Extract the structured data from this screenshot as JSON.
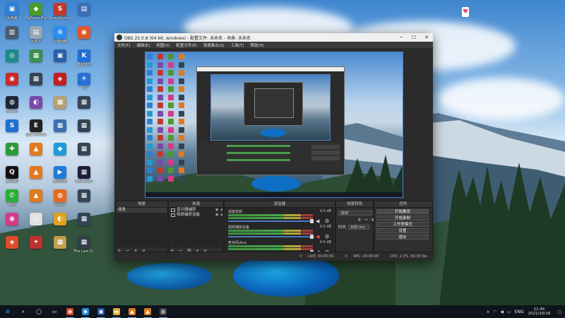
{
  "desktop": {
    "icons": [
      {
        "label": "此电脑",
        "color": "#2f7fd6",
        "glyph": "▣"
      },
      {
        "label": "GeForce Experience",
        "color": "#4c9a2a",
        "glyph": "◆"
      },
      {
        "label": "SnapGene Viewer",
        "color": "#c0392b",
        "glyph": "S"
      },
      {
        "label": "",
        "color": "#3b6fb6",
        "glyph": "▤"
      },
      {
        "label": "",
        "color": "#4a5a6a",
        "glyph": "▥"
      },
      {
        "label": "回收站",
        "color": "#9aa7b3",
        "glyph": "▤"
      },
      {
        "label": "百度网盘",
        "color": "#2d8cf0",
        "glyph": "⊙"
      },
      {
        "label": "",
        "color": "#e05a2b",
        "glyph": "◉"
      },
      {
        "label": "",
        "color": "#1c8b8b",
        "glyph": "◎"
      },
      {
        "label": "",
        "color": "#3d8f4a",
        "glyph": "▦"
      },
      {
        "label": "",
        "color": "#2a5ea8",
        "glyph": "▣"
      },
      {
        "label": "酷狗音乐",
        "color": "#1f6fd9",
        "glyph": "K"
      },
      {
        "label": "",
        "color": "#cc2a2a",
        "glyph": "◉"
      },
      {
        "label": "",
        "color": "#334455",
        "glyph": "▦"
      },
      {
        "label": "",
        "color": "#c02020",
        "glyph": "◈"
      },
      {
        "label": "飞书",
        "color": "#2a6fd6",
        "glyph": "✈"
      },
      {
        "label": "Steam",
        "color": "#1b2838",
        "glyph": "◍"
      },
      {
        "label": "",
        "color": "#7a4aa8",
        "glyph": "◐"
      },
      {
        "label": "",
        "color": "#b8a070",
        "glyph": "▦"
      },
      {
        "label": "",
        "color": "#334455",
        "glyph": "▦"
      },
      {
        "label": "",
        "color": "#1e6fd0",
        "glyph": "S"
      },
      {
        "label": "Epic Games Launcher",
        "color": "#222",
        "glyph": "E"
      },
      {
        "label": "",
        "color": "#3a6fb0",
        "glyph": "▦"
      },
      {
        "label": "",
        "color": "#334455",
        "glyph": "▦"
      },
      {
        "label": "",
        "color": "#2d9a3a",
        "glyph": "✚"
      },
      {
        "label": "",
        "color": "#e07a1f",
        "glyph": "▲"
      },
      {
        "label": "",
        "color": "#1f9bd9",
        "glyph": "◆"
      },
      {
        "label": "",
        "color": "#334455",
        "glyph": "▦"
      },
      {
        "label": "腾讯QQ",
        "color": "#111",
        "glyph": "Q"
      },
      {
        "label": "",
        "color": "#e07a1f",
        "glyph": "▲"
      },
      {
        "label": "腾讯视频",
        "color": "#1f7ad9",
        "glyph": "▶"
      },
      {
        "label": "NBA 2K21",
        "color": "#1d1d3a",
        "glyph": "▦"
      },
      {
        "label": "微信",
        "color": "#2aae3a",
        "glyph": "✆"
      },
      {
        "label": "",
        "color": "#e07a1f",
        "glyph": "▲"
      },
      {
        "label": "Origin",
        "color": "#e96a1e",
        "glyph": "◍"
      },
      {
        "label": "",
        "color": "#334455",
        "glyph": "▦"
      },
      {
        "label": "",
        "color": "#d83a8a",
        "glyph": "◉"
      },
      {
        "label": "",
        "color": "#e0e0e0",
        "glyph": "☺"
      },
      {
        "label": "",
        "color": "#e0a21f",
        "glyph": "◐"
      },
      {
        "label": "",
        "color": "#334455",
        "glyph": "▦"
      },
      {
        "label": "",
        "color": "#e04a2a",
        "glyph": "◈"
      },
      {
        "label": "",
        "color": "#c03030",
        "glyph": "✦"
      },
      {
        "label": "",
        "color": "#c0a050",
        "glyph": "▦"
      },
      {
        "label": "The Last O...",
        "color": "#33404a",
        "glyph": "▦"
      }
    ]
  },
  "obs": {
    "title": "OBS 25.0.8 (64 bit, windows) - 配置文件: 未命名 - 场景: 未命名",
    "menu": [
      "文件(F)",
      "编辑(E)",
      "视图(V)",
      "配置文件(P)",
      "场景集合(S)",
      "工具(T)",
      "帮助(H)"
    ],
    "docks": {
      "scenes": {
        "header": "场景",
        "items": [
          "场景"
        ]
      },
      "sources": {
        "header": "来源",
        "items": [
          "显示器捕获",
          "视频捕获设备"
        ]
      },
      "mixer": {
        "header": "混音器",
        "tracks": [
          {
            "name": "桌面音频",
            "db": "0.0 dB",
            "level": 0.0
          },
          {
            "name": "视频捕获设备",
            "db": "0.0 dB",
            "level": 0.0
          },
          {
            "name": "麦克风/Aux",
            "db": "0.0 dB",
            "level": 0.0
          }
        ]
      },
      "transitions": {
        "header": "场景转场",
        "type": "淡出",
        "duration_label": "时长",
        "duration": "300 ms"
      },
      "controls": {
        "header": "控件",
        "buttons": [
          "开始推流",
          "开始录制",
          "工作室模式",
          "设置",
          "退出"
        ]
      }
    },
    "status": {
      "live": "LIVE: 00:00:00",
      "rec": "REC: 00:00:00",
      "cpu": "CPU: 2.3%, 60.00 fps"
    }
  },
  "taskbar": {
    "items": [
      {
        "name": "windows-start-icon",
        "glyph": "⊞",
        "color": "#1e80e0"
      },
      {
        "name": "search-icon",
        "glyph": "⌕",
        "color": "#555"
      },
      {
        "name": "task-view-icon",
        "glyph": "◯",
        "color": "#555"
      },
      {
        "name": "task-switch-icon",
        "glyph": "▭",
        "color": "#555"
      },
      {
        "name": "chrome-icon",
        "glyph": "◉",
        "color": "#d94a2a"
      },
      {
        "name": "browser-icon",
        "glyph": "◆",
        "color": "#2a8ad9"
      },
      {
        "name": "app-icon",
        "glyph": "▣",
        "color": "#1f4fa8"
      },
      {
        "name": "folder-icon",
        "glyph": "▬",
        "color": "#e0b030"
      },
      {
        "name": "app2-icon",
        "glyph": "▲",
        "color": "#e07a1f"
      },
      {
        "name": "app3-icon",
        "glyph": "▲",
        "color": "#e07a1f"
      },
      {
        "name": "obs-icon",
        "glyph": "◍",
        "color": "#444"
      }
    ],
    "lang": "ENG",
    "time": "11:45",
    "date": "2021/10/16"
  }
}
